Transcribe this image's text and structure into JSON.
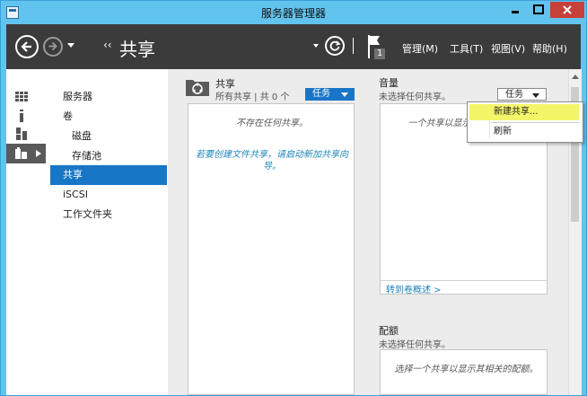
{
  "window": {
    "title": "服务器管理器"
  },
  "nav": {
    "breadcrumb_arrows": "‹‹",
    "breadcrumb": "共享",
    "notification_count": "1",
    "menu": [
      "管理(M)",
      "工具(T)",
      "视图(V)",
      "帮助(H)"
    ]
  },
  "sidebar": {
    "items": [
      {
        "label": "服务器"
      },
      {
        "label": "卷"
      },
      {
        "label": "磁盘"
      },
      {
        "label": "存储池"
      },
      {
        "label": "共享"
      },
      {
        "label": "iSCSI"
      },
      {
        "label": "工作文件夹"
      }
    ]
  },
  "shares": {
    "title": "共享",
    "subtitle": "所有共享 | 共 0 个",
    "tasks_label": "任务",
    "empty_message": "不存在任何共享。",
    "hint": "若要创建文件共享，请启动新加共享向导。"
  },
  "task_menu": {
    "items": [
      {
        "label": "新建共享..."
      },
      {
        "label": "刷新"
      }
    ]
  },
  "volume": {
    "title": "音量",
    "subtitle": "未选择任何共享。",
    "tasks_label": "任务",
    "message": "一个共享以显示其相关的卷。",
    "link": "转到卷概述 >"
  },
  "quota": {
    "title": "配额",
    "subtitle": "未选择任何共享。",
    "message": "选择一个共享以显示其相关的配额。"
  },
  "colors": {
    "titlebar": "#62c3ee",
    "navbar": "#3b3b3b",
    "accent": "#1976c7",
    "menu_highlight": "#f5f56a"
  }
}
